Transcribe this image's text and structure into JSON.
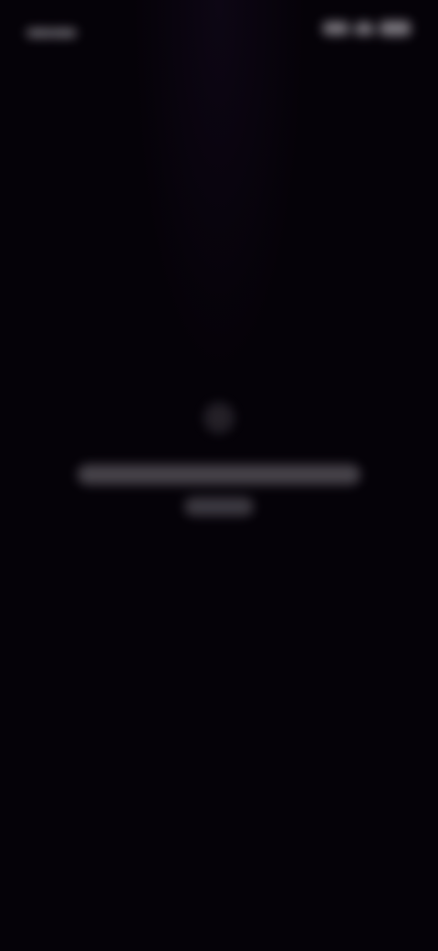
{
  "colors": {
    "background": "#050208",
    "text_dim": "#e6e1eb"
  },
  "status_bar": {
    "icons": [
      "signal-icon",
      "wifi-icon",
      "battery-icon"
    ]
  },
  "empty_state": {
    "icon": "info-icon"
  }
}
